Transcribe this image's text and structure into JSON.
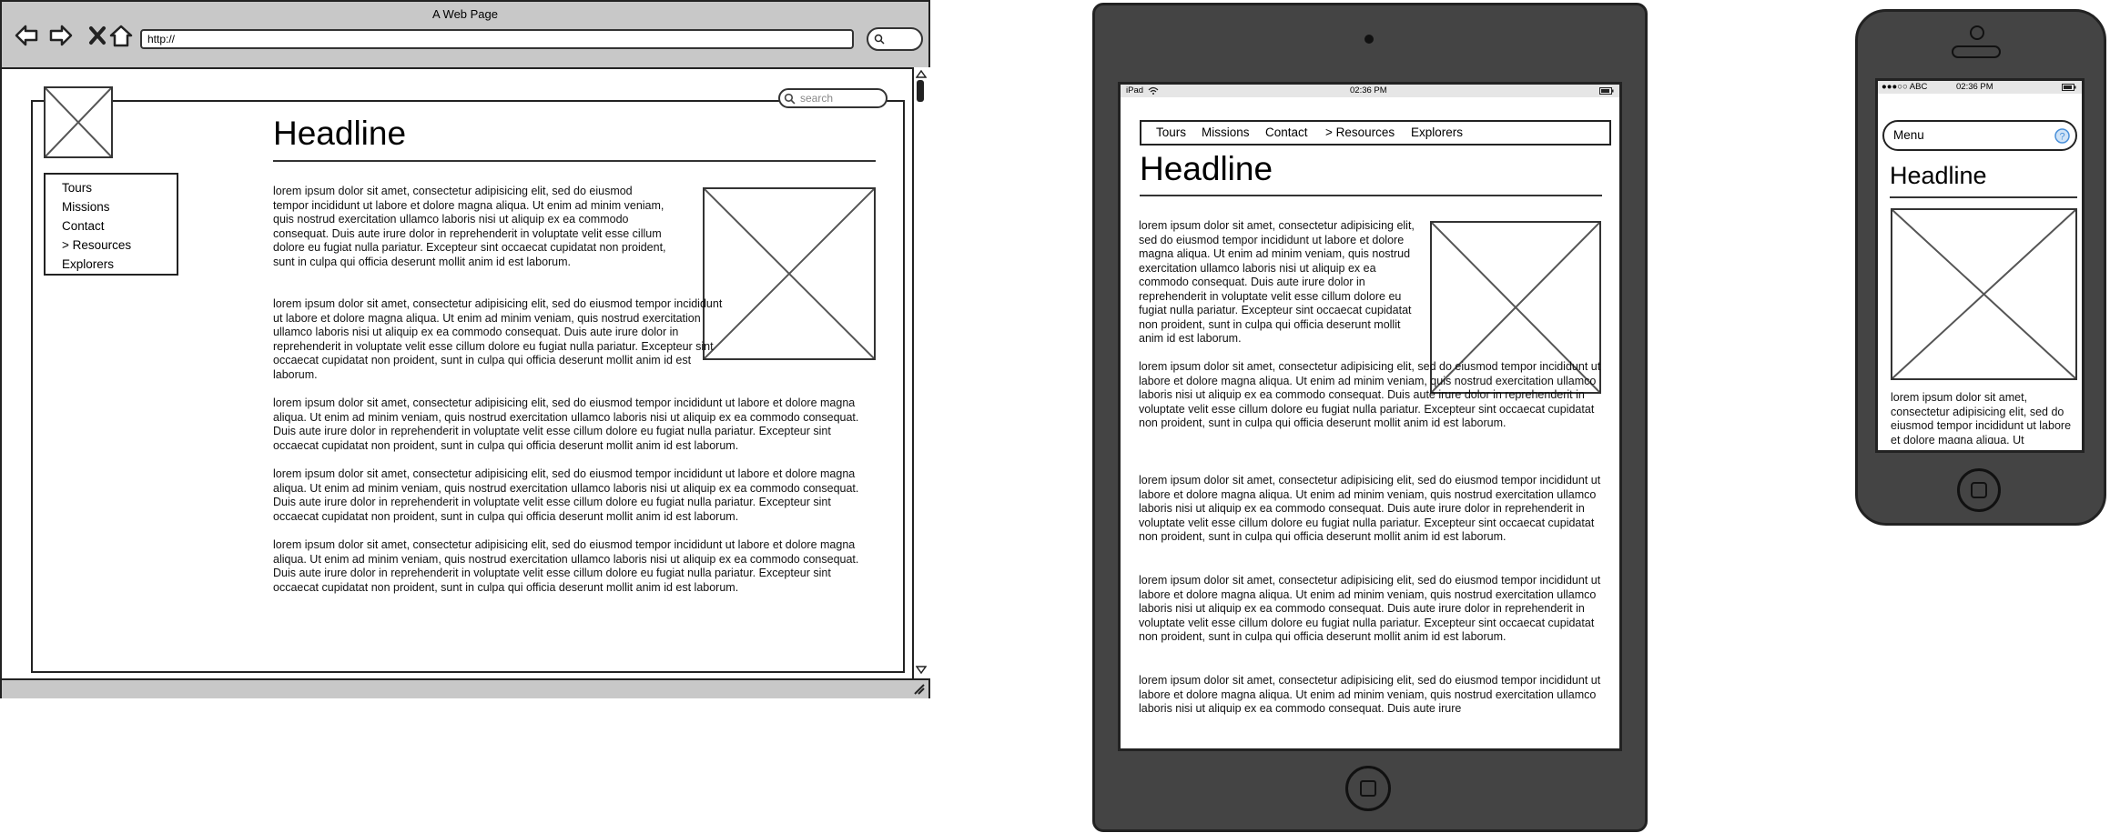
{
  "browser": {
    "title": "A Web Page",
    "url": "http://",
    "search_placeholder": "search",
    "nav_items": [
      "Tours",
      "Missions",
      "Contact",
      "> Resources",
      "Explorers"
    ],
    "headline": "Headline",
    "para_short": "lorem ipsum dolor sit amet, consectetur adipisicing elit, sed do eiusmod tempor incididunt ut labore et dolore magna aliqua. Ut enim ad minim veniam, quis nostrud exercitation ullamco laboris nisi ut aliquip ex ea commodo consequat. Duis aute irure dolor in reprehenderit in voluptate velit esse cillum dolore eu fugiat nulla pariatur. Excepteur sint occaecat cupidatat non proident, sunt in culpa qui officia deserunt mollit anim id est laborum.",
    "para_2": "lorem ipsum dolor sit amet, consectetur adipisicing elit, sed do eiusmod tempor incididunt ut labore et dolore magna aliqua. Ut enim ad minim veniam, quis nostrud exercitation ullamco laboris nisi ut aliquip ex ea commodo consequat. Duis aute irure dolor in reprehenderit in voluptate velit esse cillum dolore eu fugiat nulla pariatur. Excepteur sint occaecat cupidatat non proident, sunt in culpa qui officia deserunt mollit anim id est laborum.",
    "para_long_1": "lorem ipsum dolor sit amet, consectetur adipisicing elit, sed do eiusmod tempor incididunt ut labore et dolore magna aliqua. Ut enim ad minim veniam, quis nostrud exercitation ullamco laboris nisi ut aliquip ex ea commodo consequat. Duis aute irure dolor in reprehenderit in voluptate velit esse cillum dolore eu fugiat nulla pariatur. Excepteur sint occaecat cupidatat non proident, sunt in culpa qui officia deserunt mollit anim id est laborum.",
    "para_long_2": "lorem ipsum dolor sit amet, consectetur adipisicing elit, sed do eiusmod tempor incididunt ut labore et dolore magna aliqua. Ut enim ad minim veniam, quis nostrud exercitation ullamco laboris nisi ut aliquip ex ea commodo consequat. Duis aute irure dolor in reprehenderit in voluptate velit esse cillum dolore eu fugiat nulla pariatur. Excepteur sint occaecat cupidatat non proident, sunt in culpa qui officia deserunt mollit anim id est laborum.",
    "para_long_3": "lorem ipsum dolor sit amet, consectetur adipisicing elit, sed do eiusmod tempor incididunt ut labore et dolore magna aliqua. Ut enim ad minim veniam, quis nostrud exercitation ullamco laboris nisi ut aliquip ex ea commodo consequat. Duis aute irure dolor in reprehenderit in voluptate velit esse cillum dolore eu fugiat nulla pariatur. Excepteur sint occaecat cupidatat non proident, sunt in culpa qui officia deserunt mollit anim id est laborum."
  },
  "tablet": {
    "carrier": "iPad",
    "time": "02:36 PM",
    "nav_items": [
      "Tours",
      "Missions",
      "Contact",
      "> Resources",
      "Explorers"
    ],
    "headline": "Headline",
    "para_1": "lorem ipsum dolor sit amet, consectetur adipisicing elit, sed do eiusmod tempor incididunt ut labore et dolore magna aliqua. Ut enim ad minim veniam, quis nostrud exercitation ullamco laboris nisi ut aliquip ex ea commodo consequat. Duis aute irure dolor in reprehenderit in voluptate velit esse cillum dolore eu fugiat nulla pariatur. Excepteur sint occaecat cupidatat non proident, sunt in culpa qui officia deserunt mollit anim id est laborum.",
    "para_2": "lorem ipsum dolor sit amet, consectetur adipisicing elit, sed do eiusmod tempor incididunt ut labore et dolore magna aliqua. Ut enim ad minim veniam, quis nostrud exercitation ullamco laboris nisi ut aliquip ex ea commodo consequat. Duis aute irure dolor in reprehenderit in voluptate velit esse cillum dolore eu fugiat nulla pariatur. Excepteur sint occaecat cupidatat non proident, sunt in culpa qui officia deserunt mollit anim id est laborum.",
    "para_3": "lorem ipsum dolor sit amet, consectetur adipisicing elit, sed do eiusmod tempor incididunt ut labore et dolore magna aliqua. Ut enim ad minim veniam, quis nostrud exercitation ullamco laboris nisi ut aliquip ex ea commodo consequat. Duis aute irure dolor in reprehenderit in voluptate velit esse cillum dolore eu fugiat nulla pariatur. Excepteur sint occaecat cupidatat non proident, sunt in culpa qui officia deserunt mollit anim id est laborum.",
    "para_4": "lorem ipsum dolor sit amet, consectetur adipisicing elit, sed do eiusmod tempor incididunt ut labore et dolore magna aliqua. Ut enim ad minim veniam, quis nostrud exercitation ullamco laboris nisi ut aliquip ex ea commodo consequat. Duis aute irure dolor in reprehenderit in voluptate velit esse cillum dolore eu fugiat nulla pariatur. Excepteur sint occaecat cupidatat non proident, sunt in culpa qui officia deserunt mollit anim id est laborum.",
    "para_5": "lorem ipsum dolor sit amet, consectetur adipisicing elit, sed do eiusmod tempor incididunt ut labore et dolore magna aliqua. Ut enim ad minim veniam, quis nostrud exercitation ullamco laboris nisi ut aliquip ex ea commodo consequat. Duis aute irure"
  },
  "phone": {
    "carrier": "●●●○○ ABC",
    "time": "02:36 PM",
    "menu_label": "Menu",
    "headline": "Headline",
    "para_1": "lorem ipsum dolor sit amet, consectetur adipisicing elit, sed do eiusmod tempor incididunt ut labore et dolore magna aliqua. Ut"
  },
  "icons": {
    "back": "arrow-left-icon",
    "forward": "arrow-right-icon",
    "close": "close-icon",
    "home": "home-icon",
    "search": "search-icon",
    "image": "image-placeholder-icon",
    "wifi": "wifi-icon",
    "battery": "battery-icon",
    "home_button": "home-button-icon",
    "help": "help-icon"
  },
  "colors": {
    "chrome_gray": "#c8c8c8",
    "device_body": "#444444",
    "outline": "#222222",
    "help_blue": "#4a90d9"
  }
}
